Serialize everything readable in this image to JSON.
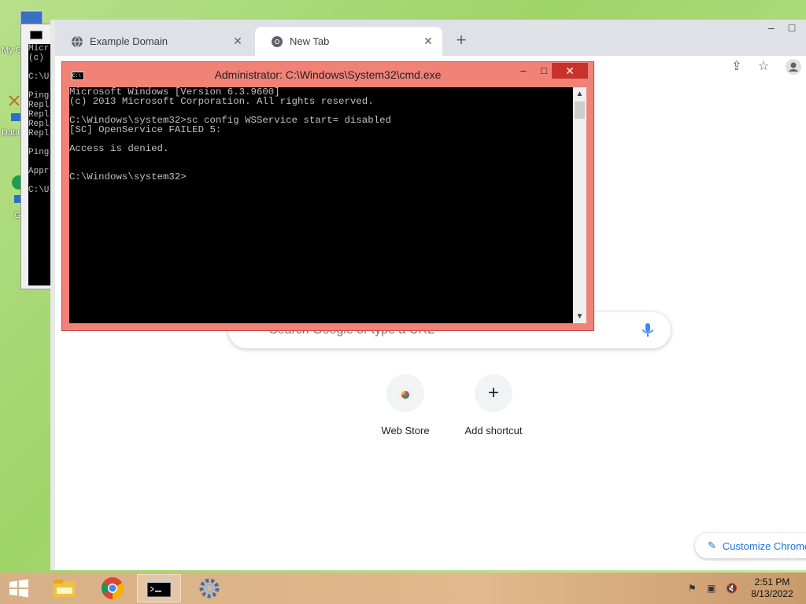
{
  "desktop": {
    "icons": [
      {
        "label": "My C",
        "icon": "computer-icon"
      },
      {
        "label": "Data",
        "icon": "data-icon"
      },
      {
        "label": "G",
        "icon": "chrome-icon"
      }
    ]
  },
  "bg_cmd": {
    "lines": "Micr\n(c)\n\nC:\\U\n\nPing\nRepl\nRepl\nRepl\nRepl\n\nPing\n\nAppr\n\nC:\\U"
  },
  "browser": {
    "tabs": [
      {
        "label": "Example Domain",
        "favicon": "globe-icon",
        "active": false
      },
      {
        "label": "New Tab",
        "favicon": "chrome-icon",
        "active": true
      }
    ],
    "new_tab_symbol": "+",
    "search_placeholder": "Search Google or type a URL",
    "shortcuts": [
      {
        "label": "Web Store",
        "icon": "webstore-icon"
      },
      {
        "label": "Add shortcut",
        "icon": "plus-icon"
      }
    ],
    "customize_label": "Customize Chrome"
  },
  "cmd": {
    "title": "Administrator: C:\\Windows\\System32\\cmd.exe",
    "output": "Microsoft Windows [Version 6.3.9600]\n(c) 2013 Microsoft Corporation. All rights reserved.\n\nC:\\Windows\\system32>sc config WSService start= disabled\n[SC] OpenService FAILED 5:\n\nAccess is denied.\n\n\nC:\\Windows\\system32>"
  },
  "taskbar": {
    "apps": [
      "file-explorer-icon",
      "chrome-icon",
      "cmd-icon",
      "settings-gear-icon"
    ],
    "time": "2:51 PM",
    "date": "8/13/2022"
  },
  "colors": {
    "cmd_title_active": "#f08278",
    "close_red": "#c7332c",
    "accent": "#1a73e8"
  }
}
